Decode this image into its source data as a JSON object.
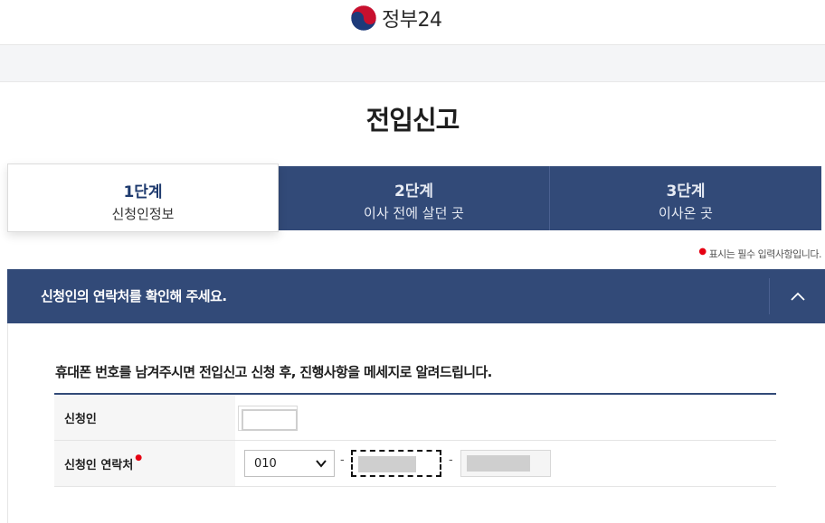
{
  "header": {
    "logo_text": "정부24",
    "logo_icon": "taegeuk-emblem-icon"
  },
  "page": {
    "title": "전입신고"
  },
  "steps": [
    {
      "num": "1단계",
      "name": "신청인정보",
      "active": true
    },
    {
      "num": "2단계",
      "name": "이사 전에 살던 곳",
      "active": false
    },
    {
      "num": "3단계",
      "name": "이사온 곳",
      "active": false
    }
  ],
  "required_note": "표시는 필수 입력사항입니다.",
  "section": {
    "title": "신청인의 연락처를 확인해 주세요.",
    "toggle_icon": "chevron-up-icon",
    "notice": "휴대폰 번호를 남겨주시면 전입신고 신청 후, 진행사항을 메세지로 알려드립니다.",
    "rows": {
      "applicant_label": "신청인",
      "contact_label": "신청인 연락처"
    },
    "phone": {
      "prefix_selected": "010",
      "dash": "-"
    }
  },
  "colors": {
    "primary": "#324a78",
    "required": "#e60012"
  }
}
